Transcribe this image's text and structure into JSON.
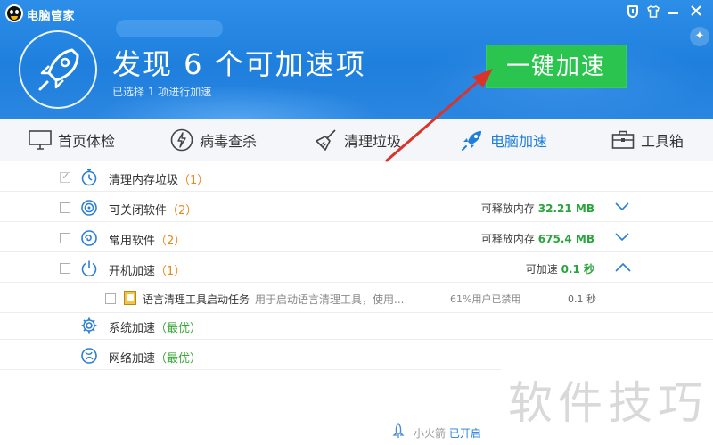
{
  "app": {
    "title": "电脑管家"
  },
  "header": {
    "main_title": "发现 6 个可加速项",
    "sub_title": "已选择 1 项进行加速",
    "action_button": "一键加速"
  },
  "nav": {
    "tabs": [
      {
        "label": "首页体检",
        "icon": "monitor-icon"
      },
      {
        "label": "病毒查杀",
        "icon": "lightning-icon"
      },
      {
        "label": "清理垃圾",
        "icon": "broom-icon"
      },
      {
        "label": "电脑加速",
        "icon": "rocket-icon",
        "active": true
      },
      {
        "label": "工具箱",
        "icon": "toolbox-icon"
      }
    ]
  },
  "list": {
    "memory": {
      "label": "清理内存垃圾",
      "count": "（1）",
      "checked": true
    },
    "closable": {
      "label": "可关闭软件",
      "count": "（2）",
      "release_label": "可释放内存",
      "release_value": "32.21 MB"
    },
    "common": {
      "label": "常用软件",
      "count": "（2）",
      "release_label": "可释放内存",
      "release_value": "675.4 MB"
    },
    "startup": {
      "label": "开机加速",
      "count": "（1）",
      "release_label": "可加速",
      "release_value": "0.1 秒"
    },
    "startup_item": {
      "name": "语言清理工具启动任务",
      "desc": "用于启动语言清理工具，使用...",
      "disabled": "61%用户已禁用",
      "time": "0.1 秒"
    },
    "system": {
      "label": "系统加速",
      "status": "（最优）"
    },
    "network": {
      "label": "网络加速",
      "status": "（最优）"
    }
  },
  "footer": {
    "label": "小火箭",
    "status": "已开启"
  },
  "watermark": "软件技巧",
  "colors": {
    "header_blue": "#1f7fdd",
    "action_green": "#2bc44e",
    "count_orange": "#e88a1c",
    "value_green": "#2aa43c",
    "arrow_red": "#d9342b"
  }
}
